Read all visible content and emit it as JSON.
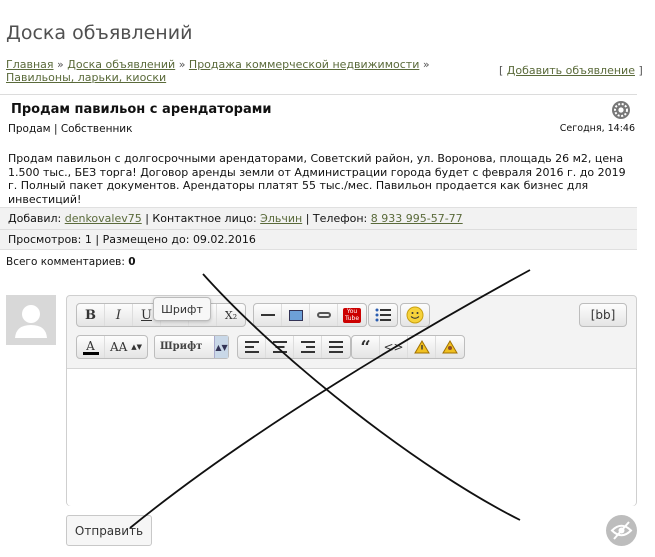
{
  "page_title": "Доска объявлений",
  "breadcrumb": {
    "items": [
      "Главная",
      "Доска объявлений",
      "Продажа коммерческой недвижимости",
      "Павильоны, ларьки, киоски"
    ],
    "separator": "»"
  },
  "add_ad": {
    "open": "[",
    "label": "Добавить объявление",
    "close": "]"
  },
  "ad": {
    "title": "Продам павильон с арендаторами",
    "meta": "Продам | Собственник",
    "date": "Сегодня, 14:46",
    "text": "Продам павильон с долгосрочными арендаторами, Советский район, ул. Воронова, площадь 26 м2, цена 1.500 тыс., БЕЗ торга! Договор аренды земли от Администрации города будет с февраля 2016 г. до 2019 г. Полный пакет документов. Арендаторы платят 55 тыс./мес. Павильон продается как бизнес для инвестиций!"
  },
  "info": {
    "added_label": "Добавил:",
    "added_user": "denkovalev75",
    "contact_label": "| Контактное лицо:",
    "contact_name": "Эльчин",
    "phone_label": "| Телефон:",
    "phone": "8 933 995-57-77",
    "views": "Просмотров: 1 | Размещено до: 09.02.2016"
  },
  "comments": {
    "label": "Всего комментариев:",
    "count": "0"
  },
  "editor": {
    "tooltip": "Шрифт",
    "font_select": "Шрифт",
    "bb_button": "[bb]",
    "row1": [
      "B",
      "I",
      "U",
      "S",
      "X²",
      "X₂",
      "—",
      "image",
      "link",
      "YouTube",
      "list",
      "smile"
    ],
    "row2": [
      "text-color",
      "AA",
      "align-left",
      "align-center",
      "align-right",
      "justify",
      "quote",
      "code",
      "spoiler",
      "hidden"
    ]
  },
  "submit_label": "Отправить"
}
